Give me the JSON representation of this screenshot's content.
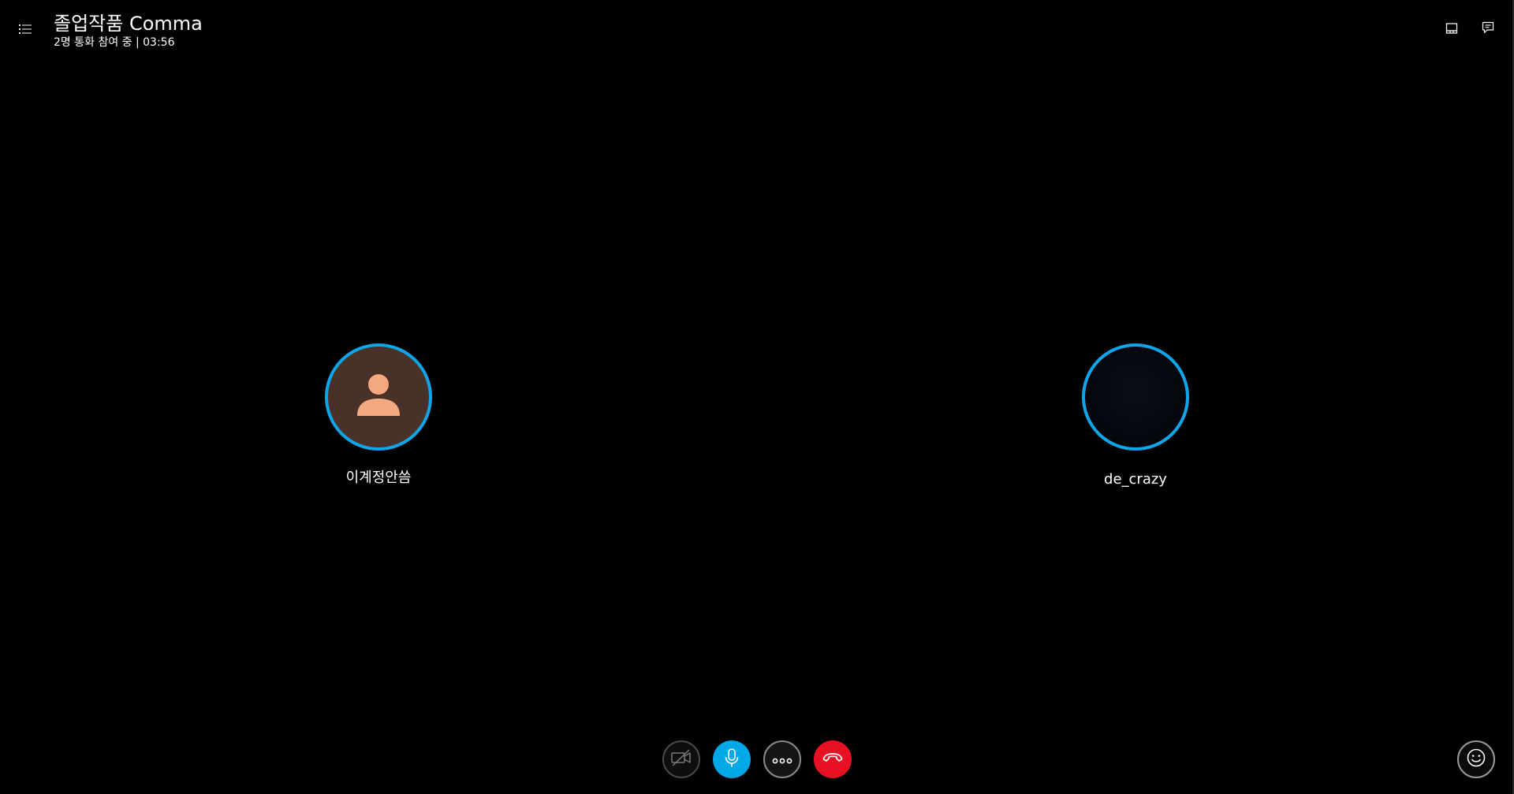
{
  "header": {
    "title": "졸업작품 Comma",
    "subtitle": "2명 통화 참여 중 | 03:56",
    "menu_icon": "list-icon",
    "layout_icon": "layout-icon",
    "chat_icon": "chat-icon"
  },
  "participants": [
    {
      "name": "이계정안씀",
      "avatar": "default-person-icon"
    },
    {
      "name": "de_crazy",
      "avatar": "photo"
    }
  ],
  "controls": {
    "video": "video-off-icon",
    "mic": "microphone-icon",
    "more": "more-icon",
    "hangup": "hang-up-icon",
    "reactions": "emoji-icon"
  },
  "colors": {
    "background": "#000000",
    "accent_ring": "#0ea5e9",
    "mic_active": "#00a8e8",
    "hangup": "#e81123",
    "avatar_bg": "#4a3128",
    "avatar_person": "#f4a97e"
  }
}
